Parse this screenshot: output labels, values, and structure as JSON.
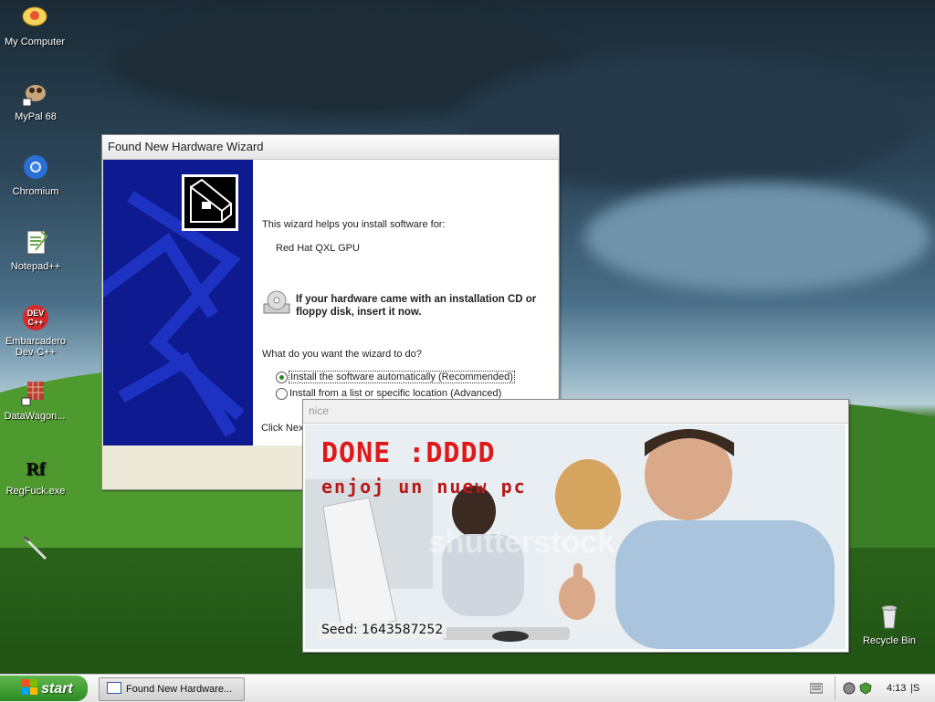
{
  "desktop": {
    "icons": [
      {
        "label": "My Computer"
      },
      {
        "label": "MyPal 68"
      },
      {
        "label": "Chromium"
      },
      {
        "label": "Notepad++"
      },
      {
        "label": "Embarcadero Dev-C++"
      },
      {
        "label": "DataWagon..."
      },
      {
        "label": "RegFuck.exe"
      },
      {
        "label": ""
      },
      {
        "label": "Recycle Bin"
      }
    ]
  },
  "wizard": {
    "title": "Found New Hardware Wizard",
    "intro": "This wizard helps you install software for:",
    "device": "Red Hat QXL GPU",
    "cd_notice": "If your hardware came with an installation CD or floppy disk, insert it now.",
    "question": "What do you want the wizard to do?",
    "option_auto": "Install the software automatically (Recommended)",
    "option_list": "Install from a list or specific location (Advanced)",
    "footer": "Click Nex"
  },
  "nice_window": {
    "title": "nice",
    "headline": "DONE :DDDD",
    "subline": "enjoj un nuew pc",
    "watermark": "shutterstock",
    "seed": "Seed: 1643587252"
  },
  "taskbar": {
    "start_label": "start",
    "task_label": "Found New Hardware...",
    "clock": "4:13",
    "clock_suffix": "|S"
  },
  "colors": {
    "wizard_panel": "#0e1a8f",
    "headline_red": "#e01818",
    "start_green": "#3c9a2e"
  }
}
